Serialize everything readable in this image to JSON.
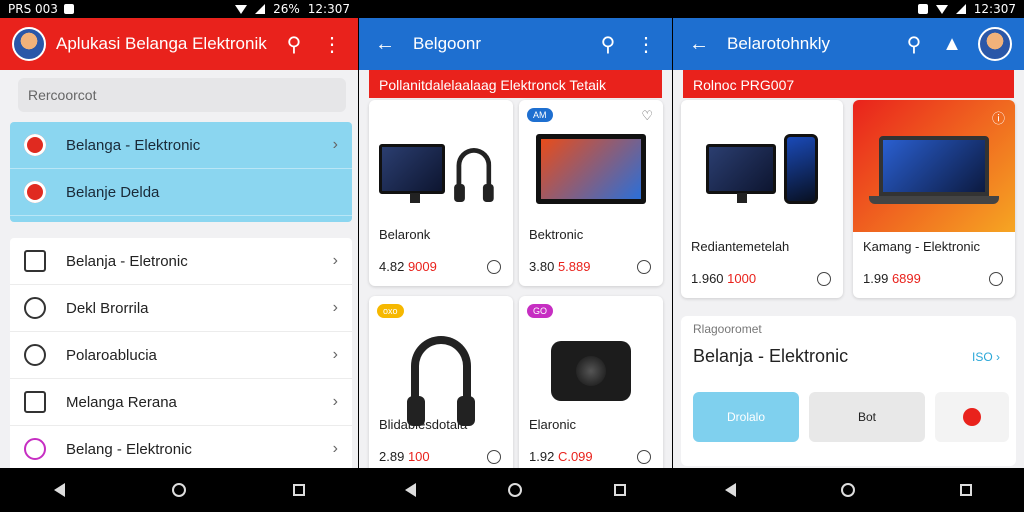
{
  "status": {
    "left": "PRS 003",
    "battery": "26%",
    "time": "12:307",
    "time3": "12:307"
  },
  "screen1": {
    "title": "Aplukasi Belanga Elektronik Terka",
    "search_placeholder": "Rercoorcot",
    "dropdown": [
      {
        "label": "Belanga - Elektronic"
      },
      {
        "label": "Belanje Delda"
      }
    ],
    "menu": [
      {
        "label": "Belanja - Eletronic",
        "icon": "tablet-icon"
      },
      {
        "label": "Dekl Brorrila",
        "icon": "clock-icon"
      },
      {
        "label": "Polaroablucia",
        "icon": "dots-icon"
      },
      {
        "label": "Melanga Rerana",
        "icon": "laptop-icon"
      },
      {
        "label": "Belang - Elektronic",
        "icon": "target-icon"
      }
    ]
  },
  "screen2": {
    "title": "Belgoonr",
    "strip": "Pollanitdalelaalaag Elektronck Tetaik",
    "products": [
      {
        "name": "Belaronk",
        "price": "4.82",
        "price_red": "9009",
        "badge": ""
      },
      {
        "name": "Bektronic",
        "price": "3.80",
        "price_red": "5.889",
        "badge": "AM"
      },
      {
        "name": "Blidablesdotala",
        "price": "2.89",
        "price_red": "100",
        "badge": "oxo"
      },
      {
        "name": "Elaronic",
        "price": "1.92",
        "price_red": "C.099",
        "badge": "GO"
      }
    ]
  },
  "screen3": {
    "title": "Belarotohnkly",
    "strip": "Rolnoc PRG007",
    "products": [
      {
        "name": "Rediantemetelah",
        "price": "1.960",
        "price_red": "1000"
      },
      {
        "name": "Kamang - Elektronic",
        "price": "1.99",
        "price_red": "6899"
      }
    ],
    "panel_small": "Rlagooromet",
    "panel_title": "Belanja - Elektronic",
    "panel_link": "ISO",
    "chip1": "Drolalo",
    "chip2": "Bot"
  },
  "colors": {
    "red": "#e9221c",
    "blue": "#1e6fd0",
    "cyan": "#8bd6f0"
  }
}
